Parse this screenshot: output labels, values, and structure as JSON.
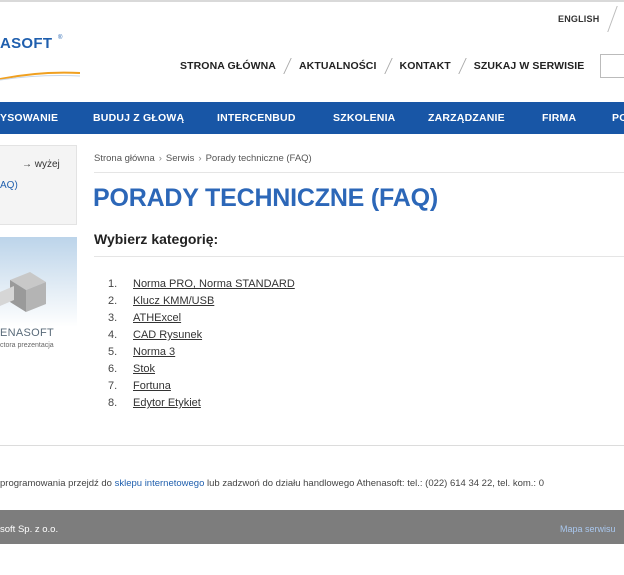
{
  "header": {
    "language_link": "ENGLISH",
    "logo_text": "ASOFT",
    "logo_reg": "®",
    "top_nav": [
      "STRONA GŁÓWNA",
      "AKTUALNOŚCI",
      "KONTAKT",
      "SZUKAJ W SERWISIE"
    ]
  },
  "main_nav": [
    "YSOWANIE",
    "BUDUJ Z GŁOWĄ",
    "INTERCENBUD",
    "SZKOLENIA",
    "ZARZĄDZANIE",
    "FIRMA",
    "PO"
  ],
  "sidebar": {
    "up_link": "→ wyżej",
    "current_item": "AQ)",
    "banner_name": "ENASOFT",
    "banner_sub": "ctora prezentacja"
  },
  "breadcrumb": [
    "Strona główna",
    "Serwis",
    "Porady techniczne (FAQ)"
  ],
  "breadcrumb_separator": "›",
  "page_title": "PORADY TECHNICZNE (FAQ)",
  "subheading": "Wybierz kategorię:",
  "categories": [
    {
      "num": "1.",
      "label": "Norma PRO, Norma STANDARD"
    },
    {
      "num": "2.",
      "label": "Klucz KMM/USB"
    },
    {
      "num": "3.",
      "label": "ATHExcel"
    },
    {
      "num": "4.",
      "label": "CAD Rysunek"
    },
    {
      "num": "5.",
      "label": "Norma 3"
    },
    {
      "num": "6.",
      "label": "Stok"
    },
    {
      "num": "7.",
      "label": "Fortuna"
    },
    {
      "num": "8.",
      "label": "Edytor Etykiet"
    }
  ],
  "footer": {
    "note_before": "programowania przejdź do ",
    "note_link": "sklepu internetowego",
    "note_after": " lub zadzwoń do działu handlowego Athenasoft: tel.: (022) 614 34 22, tel. kom.: 0",
    "copyright": "soft Sp. z o.o.",
    "sitemap": "Mapa serwisu"
  },
  "colors": {
    "brand_blue": "#1856a6",
    "title_blue": "#2c67b8",
    "footer_gray": "#7d7d7d"
  }
}
